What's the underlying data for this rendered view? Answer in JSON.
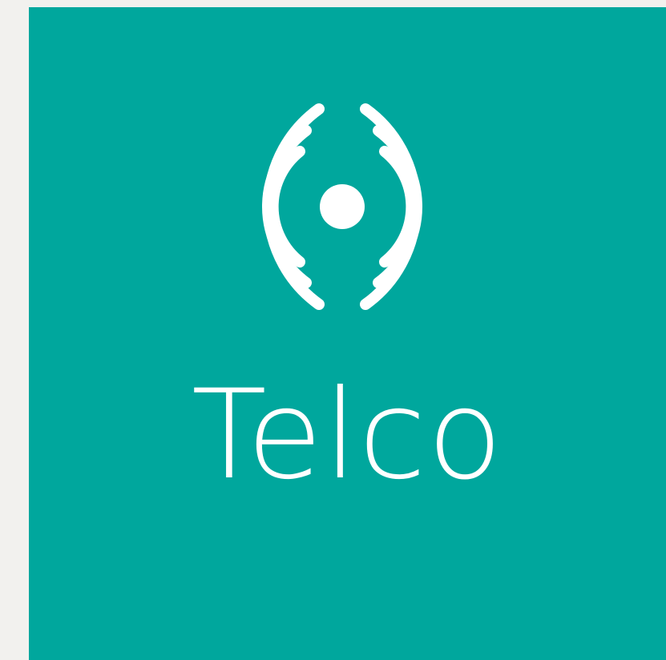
{
  "tile": {
    "background": "#00a79d",
    "title": "Telco",
    "icon": "wireless-signal-broadcast-icon"
  }
}
